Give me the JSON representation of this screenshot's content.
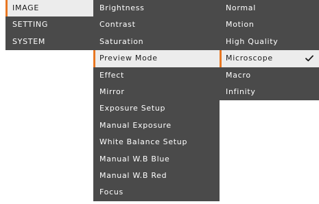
{
  "main_menu": [
    {
      "label": "IMAGE",
      "active": true
    },
    {
      "label": "SETTING",
      "active": false
    },
    {
      "label": "SYSTEM",
      "active": false
    }
  ],
  "image_menu": [
    {
      "label": "Brightness",
      "active": false
    },
    {
      "label": "Contrast",
      "active": false
    },
    {
      "label": "Saturation",
      "active": false
    },
    {
      "label": "Preview Mode",
      "active": true
    },
    {
      "label": "Effect",
      "active": false
    },
    {
      "label": "Mirror",
      "active": false
    },
    {
      "label": "Exposure Setup",
      "active": false
    },
    {
      "label": "Manual Exposure",
      "active": false
    },
    {
      "label": "White Balance Setup",
      "active": false
    },
    {
      "label": "Manual W.B Blue",
      "active": false
    },
    {
      "label": "Manual W.B Red",
      "active": false
    },
    {
      "label": "Focus",
      "active": false
    }
  ],
  "preview_mode_options": [
    {
      "label": "Normal",
      "selected": false
    },
    {
      "label": "Motion",
      "selected": false
    },
    {
      "label": "High Quality",
      "selected": false
    },
    {
      "label": "Microscope",
      "selected": true
    },
    {
      "label": "Macro",
      "selected": false
    },
    {
      "label": "Infinity",
      "selected": false
    }
  ],
  "colors": {
    "menu_background": "#4a4a4a",
    "active_background": "#ececec",
    "accent": "#e87722",
    "text": "#ffffff",
    "active_text": "#1a1a1a"
  },
  "icons": {
    "selected_option": "check-icon"
  }
}
